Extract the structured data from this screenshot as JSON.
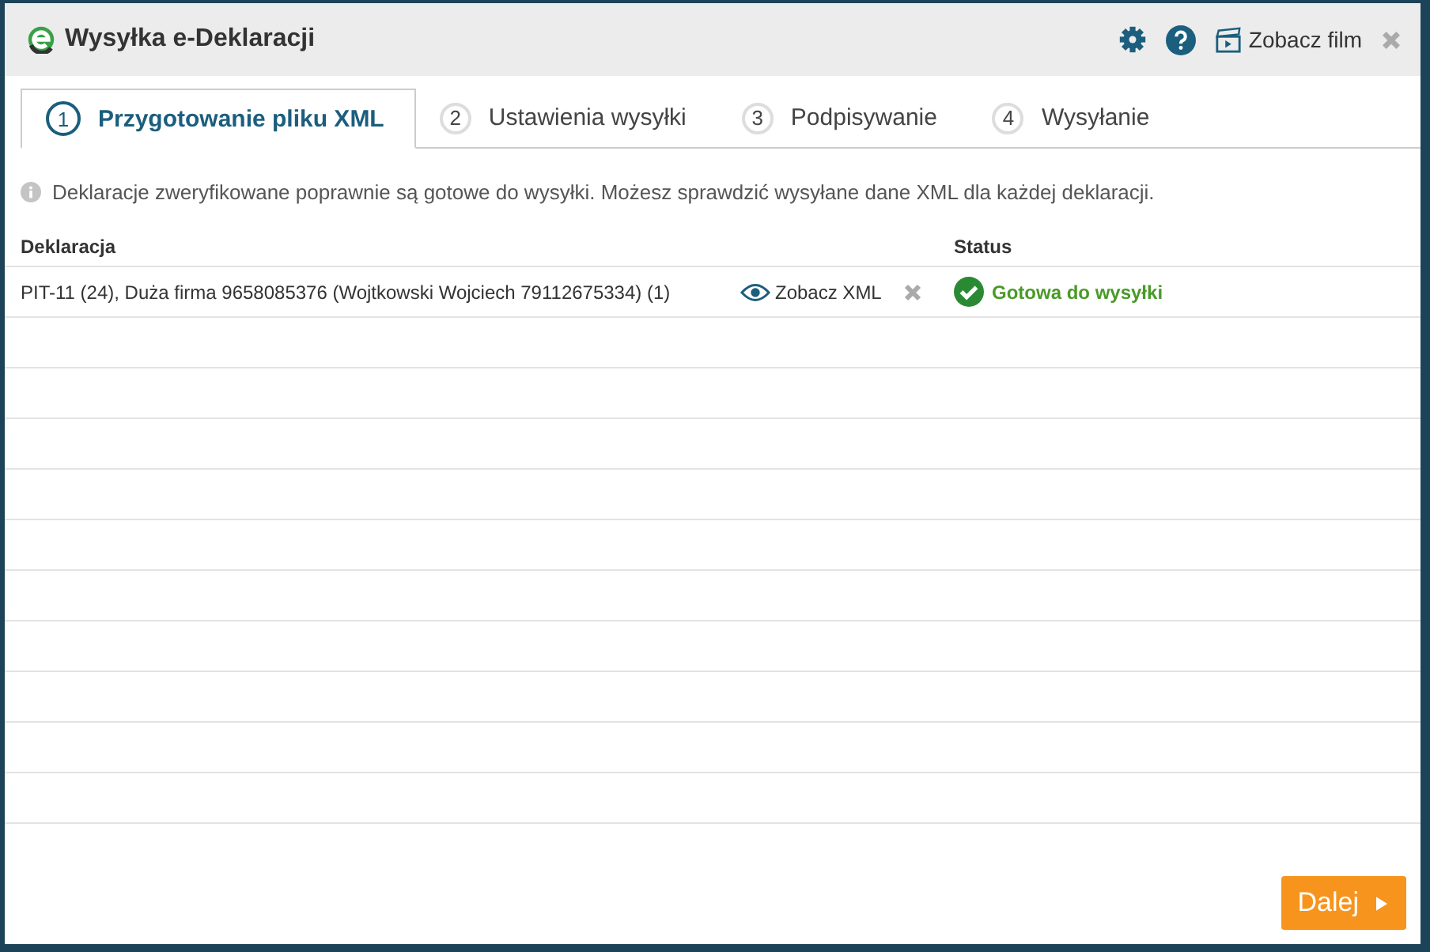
{
  "window": {
    "title": "Wysyłka e-Deklaracji",
    "video_link": "Zobacz film"
  },
  "tabs": [
    {
      "number": "1",
      "label": "Przygotowanie pliku XML",
      "selected": true
    },
    {
      "number": "2",
      "label": "Ustawienia wysyłki",
      "selected": false
    },
    {
      "number": "3",
      "label": "Podpisywanie",
      "selected": false
    },
    {
      "number": "4",
      "label": "Wysyłanie",
      "selected": false
    }
  ],
  "info": "Deklaracje zweryfikowane poprawnie są gotowe do wysyłki. Możesz sprawdzić wysyłane dane XML dla każdej deklaracji.",
  "table": {
    "columns": [
      "Deklaracja",
      "Status"
    ],
    "rows": [
      {
        "declaration": "PIT-11 (24), Duża firma 9658085376 (Wojtkowski Wojciech 79112675334) (1)",
        "action": "Zobacz XML",
        "status": "Gotowa do wysyłki",
        "kind": "ready"
      }
    ]
  },
  "next_button": "Dalej"
}
